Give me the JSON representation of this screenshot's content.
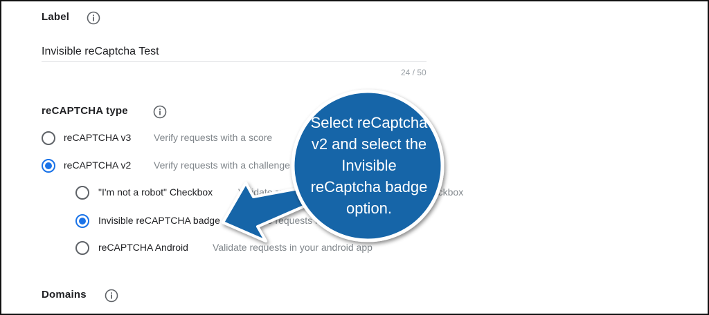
{
  "label_section": {
    "title": "Label",
    "info_icon": "info-icon",
    "value": "Invisible reCaptcha Test",
    "counter": "24 / 50"
  },
  "type_section": {
    "title": "reCAPTCHA type",
    "info_icon": "info-icon",
    "options": [
      {
        "label": "reCAPTCHA v3",
        "description": "Verify requests with a score",
        "selected": false
      },
      {
        "label": "reCAPTCHA v2",
        "description": "Verify requests with a challenge",
        "selected": true
      }
    ],
    "suboptions": [
      {
        "label": "\"I'm not a robot\" Checkbox",
        "description": "Validate requests with the \"I'm not a robot\" checkbox",
        "selected": false
      },
      {
        "label": "Invisible reCAPTCHA badge",
        "description": "Validate requests in the background",
        "selected": true
      },
      {
        "label": "reCAPTCHA Android",
        "description": "Validate requests in your android app",
        "selected": false
      }
    ]
  },
  "domains_section": {
    "title": "Domains",
    "info_icon": "info-icon"
  },
  "callout": {
    "lines": [
      "Select reCaptcha",
      "v2 and select the",
      "Invisible",
      "reCaptcha badge",
      "option."
    ],
    "color": "#1565a8"
  },
  "colors": {
    "accent": "#1a73e8",
    "callout_fill": "#1565a8",
    "callout_border": "#ffffff"
  }
}
